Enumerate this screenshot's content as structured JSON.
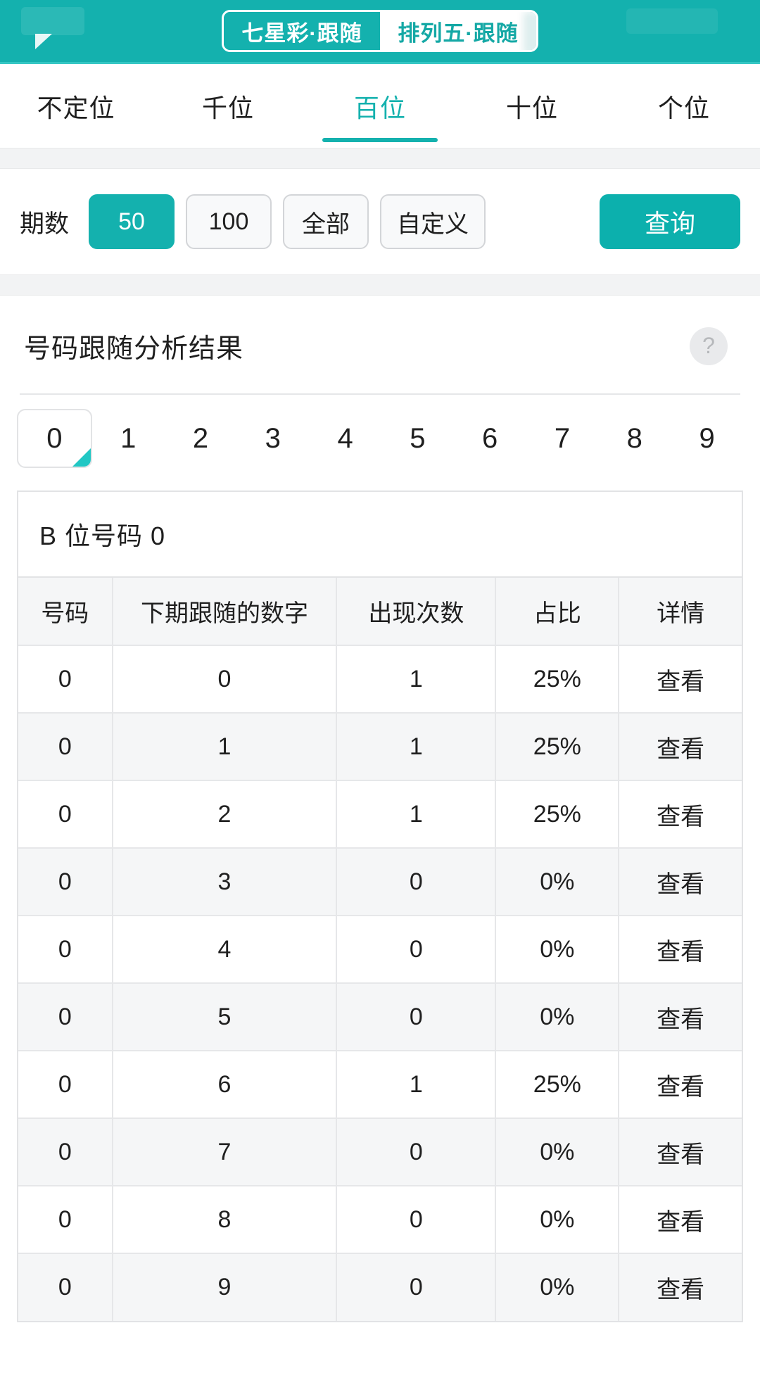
{
  "topbar": {
    "segments": [
      {
        "label": "七星彩·跟随",
        "active": true
      },
      {
        "label": "排列五·跟随",
        "active": false
      }
    ],
    "accent_color": "#14b1ae"
  },
  "position_tabs": [
    {
      "label": "不定位",
      "active": false
    },
    {
      "label": "千位",
      "active": false
    },
    {
      "label": "百位",
      "active": true
    },
    {
      "label": "十位",
      "active": false
    },
    {
      "label": "个位",
      "active": false
    }
  ],
  "filter": {
    "label": "期数",
    "options": [
      {
        "label": "50",
        "selected": true
      },
      {
        "label": "100",
        "selected": false
      },
      {
        "label": "全部",
        "selected": false
      },
      {
        "label": "自定义",
        "selected": false
      }
    ],
    "query_label": "查询"
  },
  "result": {
    "title": "号码跟随分析结果",
    "help_icon": "question-mark",
    "digits": [
      "0",
      "1",
      "2",
      "3",
      "4",
      "5",
      "6",
      "7",
      "8",
      "9"
    ],
    "selected_digit": "0",
    "card_title": "B 位号码 0",
    "columns": [
      "号码",
      "下期跟随的数字",
      "出现次数",
      "占比",
      "详情"
    ],
    "rows": [
      {
        "number": "0",
        "follow": "0",
        "count": "1",
        "ratio": "25%",
        "detail": "查看"
      },
      {
        "number": "0",
        "follow": "1",
        "count": "1",
        "ratio": "25%",
        "detail": "查看"
      },
      {
        "number": "0",
        "follow": "2",
        "count": "1",
        "ratio": "25%",
        "detail": "查看"
      },
      {
        "number": "0",
        "follow": "3",
        "count": "0",
        "ratio": "0%",
        "detail": "查看"
      },
      {
        "number": "0",
        "follow": "4",
        "count": "0",
        "ratio": "0%",
        "detail": "查看"
      },
      {
        "number": "0",
        "follow": "5",
        "count": "0",
        "ratio": "0%",
        "detail": "查看"
      },
      {
        "number": "0",
        "follow": "6",
        "count": "1",
        "ratio": "25%",
        "detail": "查看"
      },
      {
        "number": "0",
        "follow": "7",
        "count": "0",
        "ratio": "0%",
        "detail": "查看"
      },
      {
        "number": "0",
        "follow": "8",
        "count": "0",
        "ratio": "0%",
        "detail": "查看"
      },
      {
        "number": "0",
        "follow": "9",
        "count": "0",
        "ratio": "0%",
        "detail": "查看"
      }
    ]
  }
}
